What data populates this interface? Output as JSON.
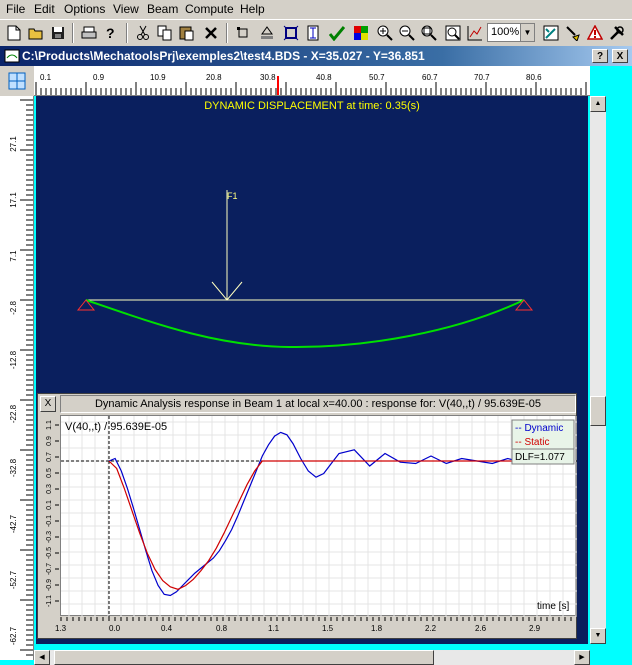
{
  "menu": [
    "File",
    "Edit",
    "Options",
    "View",
    "Beam",
    "Compute",
    "Help"
  ],
  "toolbar": {
    "zoom": "100%",
    "icons": [
      "new-icon",
      "open-icon",
      "save-icon",
      "print-icon",
      "help-icon",
      "cut-icon",
      "copy-icon",
      "paste-icon",
      "delete-icon",
      "node-icon",
      "support-icon",
      "element-icon",
      "section-icon",
      "check-icon",
      "material-icon",
      "zoom-in-icon",
      "zoom-out-icon",
      "zoom-fit-icon",
      "zoom-window-icon",
      "graph-icon",
      "pointer-icon",
      "load-icon",
      "tools-icon"
    ]
  },
  "window": {
    "title": "C:\\Products\\MechatoolsPrj\\exemples2\\test4.BDS - X=35.027 - Y=36.851",
    "help_button": "?",
    "close_button": "X"
  },
  "hruler_labels": [
    "0.1",
    "0.9",
    "10.9",
    "20.8",
    "30.8",
    "40.8",
    "50.7",
    "60.7",
    "70.7",
    "80.6"
  ],
  "vruler_labels": [
    "27.1",
    "17.1",
    "7.1",
    "-2.8",
    "-12.8",
    "-22.8",
    "-32.8",
    "-42.7",
    "-52.7",
    "-62.7"
  ],
  "canvas": {
    "title": "DYNAMIC  DISPLACEMENT at time: 0.35(s)",
    "load_label": "F1",
    "colors": {
      "background": "#0a1f5e",
      "beam": "#ffffc0",
      "deflection": "#00e000",
      "title": "#ffff00",
      "support": "#ff3030"
    }
  },
  "response": {
    "close_button": "X",
    "title": "Dynamic Analysis response in Beam 1 at local x=40.00 : response for: V(40,,t) / 95.639E-05",
    "plot_label": "V(40,,t) / 95.639E-05",
    "legend": {
      "dynamic": "-- Dynamic",
      "static": "-- Static",
      "dlf": "DLF=1.077"
    },
    "x_axis_label": "time [s]",
    "y_tick_labels": [
      "1.1",
      "0.9",
      "0.7",
      "0.5",
      "0.3",
      "0.1",
      "-0.1",
      "-0.3",
      "-0.5",
      "-0.7",
      "-0.9",
      "-1.1"
    ],
    "x_tick_labels": [
      "1.3",
      "0.0",
      "0.4",
      "0.8",
      "1.1",
      "1.5",
      "1.8",
      "2.2",
      "2.6",
      "2.9"
    ]
  },
  "chart_data": {
    "type": "line",
    "xlabel": "time [s]",
    "ylabel": "V(40,,t) / 95.639E-05",
    "xlim": [
      0,
      3.0
    ],
    "ylim": [
      -1.1,
      0.2
    ],
    "series": [
      {
        "name": "Dynamic",
        "color": "#0000cc",
        "x": [
          0.0,
          0.04,
          0.08,
          0.12,
          0.16,
          0.2,
          0.24,
          0.28,
          0.32,
          0.36,
          0.4,
          0.44,
          0.48,
          0.52,
          0.56,
          0.6,
          0.64,
          0.68,
          0.72,
          0.76,
          0.8,
          0.84,
          0.88,
          0.92,
          0.96,
          1.0,
          1.04,
          1.08,
          1.12,
          1.16,
          1.2,
          1.25,
          1.3,
          1.35,
          1.4,
          1.45,
          1.5,
          1.6,
          1.7,
          1.8,
          1.9,
          2.0,
          2.1,
          2.2,
          2.3,
          2.4,
          2.5,
          2.6,
          2.7,
          2.8,
          2.9,
          3.0
        ],
        "values": [
          0.0,
          0.02,
          -0.08,
          -0.22,
          -0.38,
          -0.55,
          -0.72,
          -0.88,
          -1.0,
          -1.07,
          -1.08,
          -1.05,
          -1.0,
          -0.95,
          -0.9,
          -0.86,
          -0.82,
          -0.78,
          -0.72,
          -0.64,
          -0.55,
          -0.44,
          -0.32,
          -0.2,
          -0.08,
          0.04,
          0.13,
          0.2,
          0.23,
          0.21,
          0.14,
          0.02,
          -0.08,
          -0.13,
          -0.1,
          -0.02,
          0.06,
          0.09,
          -0.04,
          0.06,
          -0.01,
          -0.02,
          0.04,
          -0.02,
          0.02,
          0.0,
          -0.02,
          0.02,
          -0.01,
          0.01,
          0.02,
          0.0
        ]
      },
      {
        "name": "Static",
        "color": "#d00000",
        "x": [
          0.0,
          0.05,
          0.1,
          0.15,
          0.2,
          0.25,
          0.3,
          0.35,
          0.4,
          0.45,
          0.5,
          0.55,
          0.6,
          0.65,
          0.7,
          0.75,
          0.8,
          0.85,
          0.9,
          0.95,
          1.0,
          1.05,
          1.1,
          1.2,
          1.5,
          2.0,
          2.5,
          3.0
        ],
        "values": [
          0.0,
          -0.06,
          -0.22,
          -0.4,
          -0.58,
          -0.74,
          -0.87,
          -0.96,
          -1.01,
          -1.03,
          -1.0,
          -0.95,
          -0.88,
          -0.8,
          -0.7,
          -0.58,
          -0.45,
          -0.32,
          -0.19,
          -0.08,
          0.0,
          0.0,
          0.0,
          0.0,
          0.0,
          0.0,
          0.0,
          0.0
        ]
      }
    ]
  }
}
